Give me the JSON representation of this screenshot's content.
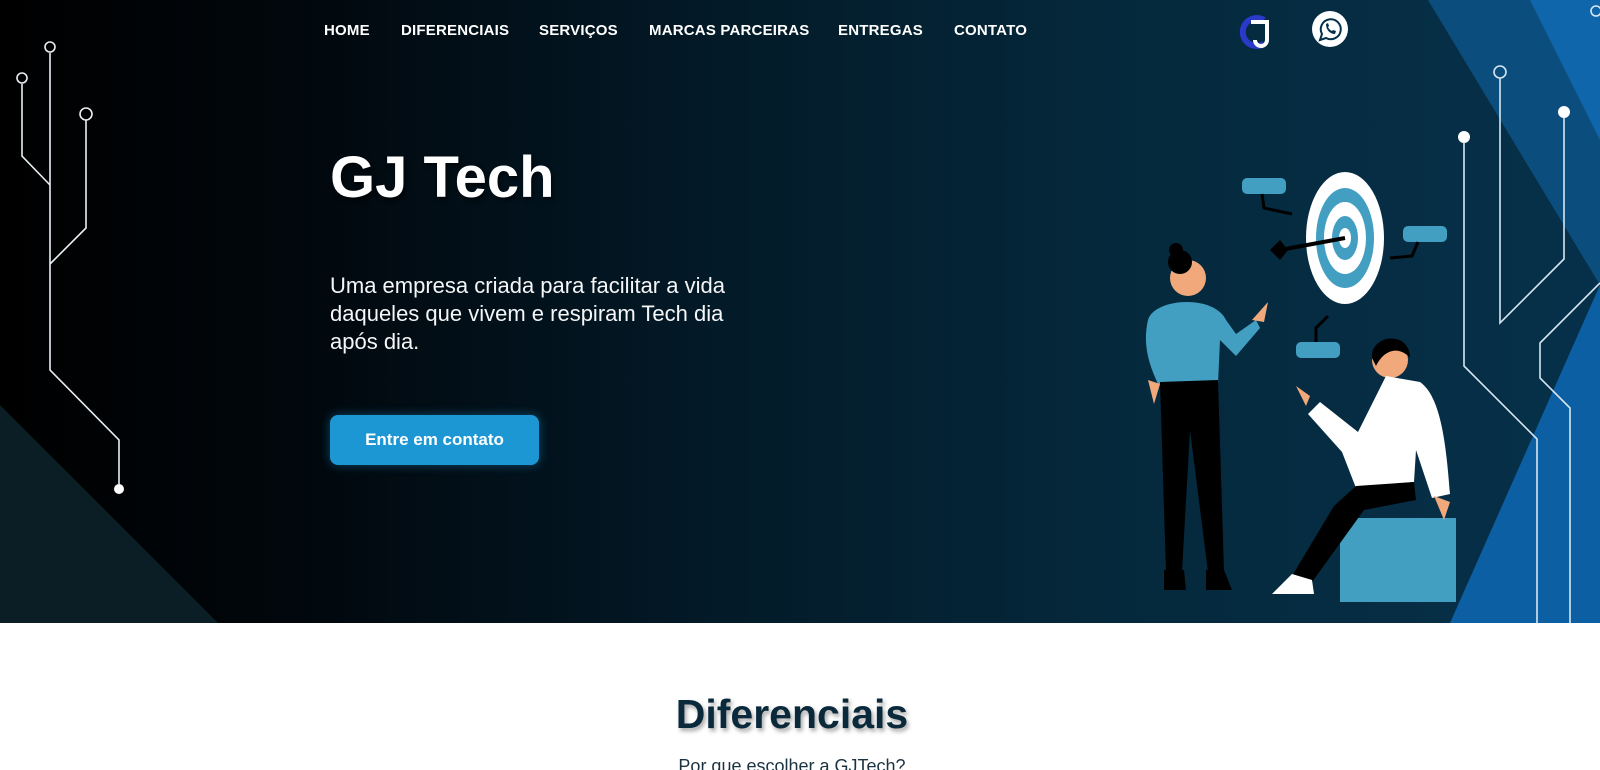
{
  "nav": {
    "items": [
      {
        "label": "HOME"
      },
      {
        "label": "DIFERENCIAIS"
      },
      {
        "label": "SERVIÇOS"
      },
      {
        "label": "MARCAS PARCEIRAS"
      },
      {
        "label": "ENTREGAS"
      },
      {
        "label": "CONTATO"
      }
    ]
  },
  "header": {
    "logo_text": "GJ",
    "logo_icon": "gj-logo",
    "whatsapp_icon": "whatsapp-icon"
  },
  "hero": {
    "title": "GJ Tech",
    "description": "Uma empresa criada para facilitar a vida daqueles que vivem e respiram Tech dia após dia.",
    "cta_label": "Entre em contato"
  },
  "differentials": {
    "title": "Diferenciais",
    "subtitle": "Por que escolher a GJTech?"
  },
  "colors": {
    "accent": "#1d97d3",
    "hero_dark": "#000000",
    "hero_blue": "#06304a",
    "illustration_blue": "#439fc2",
    "section_title": "#0a2a3b"
  }
}
